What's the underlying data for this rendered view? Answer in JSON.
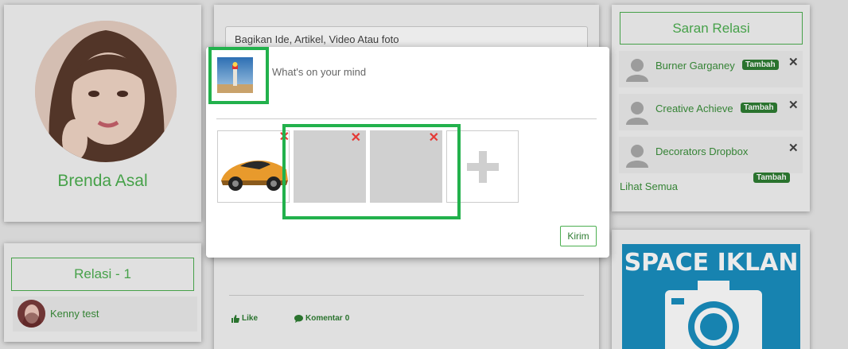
{
  "profile": {
    "name": "Brenda Asal"
  },
  "relasi": {
    "title": "Relasi - 1",
    "items": [
      {
        "name": "Kenny test"
      }
    ]
  },
  "feed": {
    "input_placeholder": "Bagikan Ide, Artikel, Video Atau foto",
    "actions": {
      "like": "Like",
      "comment": "Komentar",
      "comment_count": "0"
    }
  },
  "saran": {
    "title": "Saran Relasi",
    "items": [
      {
        "name": "Burner Garganey",
        "badge": "Tambah"
      },
      {
        "name": "Creative Achieve",
        "badge": "Tambah"
      },
      {
        "name": "Decorators Dropbox",
        "badge": "Tambah"
      }
    ],
    "see_all": "Lihat Semua",
    "close_symbol": "✕"
  },
  "ad": {
    "text": "SPACE IKLAN"
  },
  "modal": {
    "placeholder": "What's on your mind",
    "remove_symbol": "✕",
    "submit_label": "Kirim"
  },
  "colors": {
    "accent": "#4caf50",
    "badge": "#2e7d32",
    "highlight": "#22b14c",
    "remove": "#e53935",
    "ad_background": "#1a8fbf"
  },
  "icons": {
    "like": "thumbs-up-icon",
    "comment": "comment-icon",
    "add": "plus-icon",
    "remove": "close-icon"
  }
}
